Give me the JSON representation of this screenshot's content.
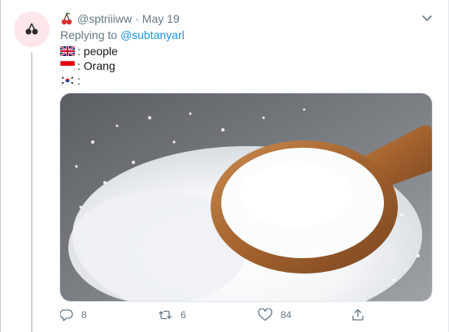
{
  "tweet": {
    "avatar_icon": "cherry-avatar-icon",
    "username_icon": "cherry-icon",
    "handle": "@sptriiiww",
    "separator": "·",
    "date": "May 19",
    "reply_prefix": "Replying to",
    "reply_to": "@subtanyarl",
    "lines": [
      {
        "flag_icon": "uk-flag-icon",
        "text": ": people"
      },
      {
        "flag_icon": "indonesia-flag-icon",
        "text": ": Orang"
      },
      {
        "flag_icon": "south-korea-flag-icon",
        "text": ":"
      }
    ],
    "media": {
      "description_icon": "salt-wooden-spoon-photo"
    }
  },
  "actions": {
    "reply": {
      "icon": "reply-icon",
      "count": "8"
    },
    "retweet": {
      "icon": "retweet-icon",
      "count": "6"
    },
    "like": {
      "icon": "heart-icon",
      "count": "84"
    },
    "share": {
      "icon": "share-icon"
    }
  },
  "colors": {
    "text": "#14171a",
    "secondary": "#657786",
    "link": "#1b95e0",
    "thread_line": "#ccd6dd"
  }
}
